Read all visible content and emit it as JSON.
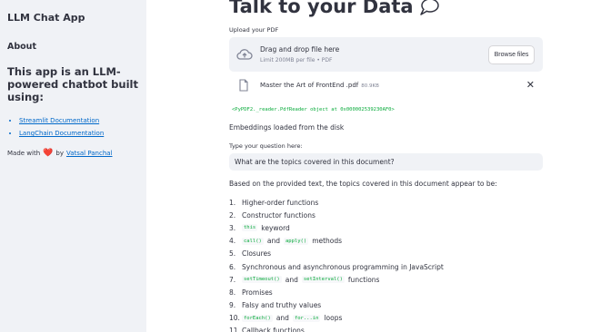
{
  "sidebar": {
    "app_title": "LLM Chat App",
    "about": "About",
    "heading": "This app is an LLM-powered chatbot built using:",
    "links": [
      "Streamlit Documentation",
      "LangChain Documentation"
    ],
    "made_with": "Made with",
    "heart": "❤️",
    "by": "by",
    "author": "Vatsal Panchal"
  },
  "main": {
    "title": "Talk to your Data",
    "upload_label": "Upload your PDF",
    "dropzone": {
      "main": "Drag and drop file here",
      "sub": "Limit 200MB per file • PDF",
      "browse": "Browse files"
    },
    "file": {
      "name": "Master the Art of FrontEnd .pdf",
      "size": "80.9KB",
      "remove": "✕"
    },
    "object_repr": "<PyPDF2._reader.PdfReader object at 0x000002539230AF0>",
    "embeddings_status": "Embeddings loaded from the disk",
    "question_label": "Type your question here:",
    "question_value": "What are the topics covered in this document?",
    "answer_intro": "Based on the provided text, the topics covered in this document appear to be:",
    "topics": [
      {
        "num": "1.",
        "parts": [
          {
            "t": "text",
            "v": "Higher-order functions"
          }
        ]
      },
      {
        "num": "2.",
        "parts": [
          {
            "t": "text",
            "v": "Constructor functions"
          }
        ]
      },
      {
        "num": "3.",
        "parts": [
          {
            "t": "code",
            "v": "this"
          },
          {
            "t": "text",
            "v": "keyword"
          }
        ]
      },
      {
        "num": "4.",
        "parts": [
          {
            "t": "code",
            "v": "call()"
          },
          {
            "t": "text",
            "v": "and"
          },
          {
            "t": "code",
            "v": "apply()"
          },
          {
            "t": "text",
            "v": "methods"
          }
        ]
      },
      {
        "num": "5.",
        "parts": [
          {
            "t": "text",
            "v": "Closures"
          }
        ]
      },
      {
        "num": "6.",
        "parts": [
          {
            "t": "text",
            "v": "Synchronous and asynchronous programming in JavaScript"
          }
        ]
      },
      {
        "num": "7.",
        "parts": [
          {
            "t": "code",
            "v": "setTimeout()"
          },
          {
            "t": "text",
            "v": "and"
          },
          {
            "t": "code",
            "v": "setInterval()"
          },
          {
            "t": "text",
            "v": "functions"
          }
        ]
      },
      {
        "num": "8.",
        "parts": [
          {
            "t": "text",
            "v": "Promises"
          }
        ]
      },
      {
        "num": "9.",
        "parts": [
          {
            "t": "text",
            "v": "Falsy and truthy values"
          }
        ]
      },
      {
        "num": "10.",
        "parts": [
          {
            "t": "code",
            "v": "forEach()"
          },
          {
            "t": "text",
            "v": "and"
          },
          {
            "t": "code",
            "v": "for...in"
          },
          {
            "t": "text",
            "v": "loops"
          }
        ]
      },
      {
        "num": "11.",
        "parts": [
          {
            "t": "text",
            "v": "Callback functions"
          }
        ]
      }
    ]
  },
  "colors": {
    "sidebar_bg": "#f0f2f6",
    "link": "#0068c9",
    "code_green": "#09ab3b",
    "heart": "#d61f3b"
  },
  "icons": [
    "speech-bubble-icon",
    "cloud-upload-icon",
    "file-icon",
    "close-icon",
    "heart-icon"
  ]
}
